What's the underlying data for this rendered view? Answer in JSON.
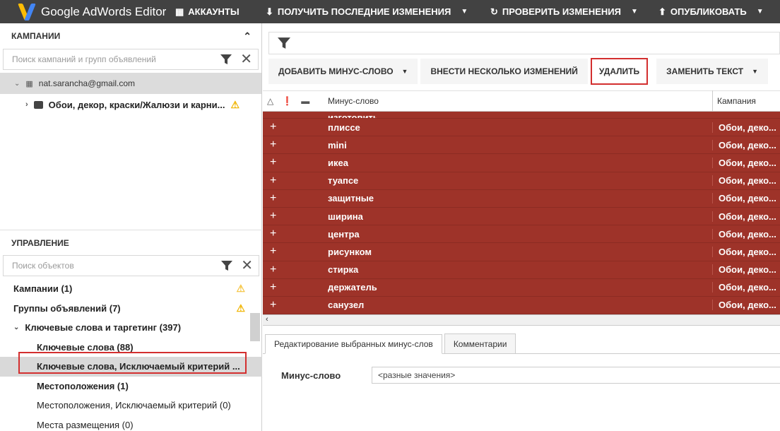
{
  "app": {
    "title": "Google AdWords Editor"
  },
  "toolbar_top": {
    "accounts": "АККАУНТЫ",
    "get_changes": "ПОЛУЧИТЬ ПОСЛЕДНИЕ ИЗМЕНЕНИЯ",
    "check_changes": "ПРОВЕРИТЬ ИЗМЕНЕНИЯ",
    "publish": "ОПУБЛИКОВАТЬ"
  },
  "campaigns_panel": {
    "title": "КАМПАНИИ",
    "search_placeholder": "Поиск кампаний и групп объявлений",
    "account": "nat.sarancha@gmail.com",
    "campaign": "Обои, декор, краски/Жалюзи и карни..."
  },
  "management_panel": {
    "title": "УПРАВЛЕНИЕ",
    "search_placeholder": "Поиск объектов",
    "items": [
      {
        "label": "Кампании (1)"
      },
      {
        "label": "Группы объявлений (7)"
      },
      {
        "label": "Ключевые слова и таргетинг (397)"
      },
      {
        "label": "Ключевые слова (88)"
      },
      {
        "label": "Ключевые слова, Исключаемый критерий ..."
      },
      {
        "label": "Местоположения (1)"
      },
      {
        "label": "Местоположения, Исключаемый критерий (0)"
      },
      {
        "label": "Места размещения (0)"
      }
    ]
  },
  "actions": {
    "add_negative": "ДОБАВИТЬ МИНУС-СЛОВО",
    "multiple_changes": "ВНЕСТИ НЕСКОЛЬКО ИЗМЕНЕНИЙ",
    "delete": "УДАЛИТЬ",
    "replace_text": "ЗАМЕНИТЬ ТЕКСТ"
  },
  "grid": {
    "col_keyword": "Минус-слово",
    "col_campaign": "Кампания",
    "partial_row": "изготовить",
    "rows": [
      {
        "keyword": "плиссе",
        "campaign": "Обои, деко..."
      },
      {
        "keyword": "mini",
        "campaign": "Обои, деко..."
      },
      {
        "keyword": "икеа",
        "campaign": "Обои, деко..."
      },
      {
        "keyword": "туапсе",
        "campaign": "Обои, деко..."
      },
      {
        "keyword": "защитные",
        "campaign": "Обои, деко..."
      },
      {
        "keyword": "ширина",
        "campaign": "Обои, деко..."
      },
      {
        "keyword": "центра",
        "campaign": "Обои, деко..."
      },
      {
        "keyword": "рисунком",
        "campaign": "Обои, деко..."
      },
      {
        "keyword": "стирка",
        "campaign": "Обои, деко..."
      },
      {
        "keyword": "держатель",
        "campaign": "Обои, деко..."
      },
      {
        "keyword": "санузел",
        "campaign": "Обои, деко..."
      }
    ],
    "row_color": "#9e3329"
  },
  "editor": {
    "tab_edit": "Редактирование выбранных минус-слов",
    "tab_comments": "Комментарии",
    "field_label": "Минус-слово",
    "field_value": "<разные значения>"
  },
  "colors": {
    "topbar": "#424242",
    "highlight": "#d32f2f",
    "warning": "#f0b400"
  }
}
